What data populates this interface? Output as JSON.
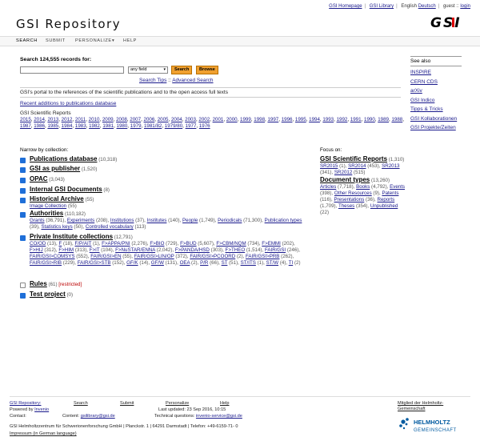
{
  "topbar": {
    "homepage": "GSI Homepage",
    "library": "GSI Library",
    "lang_current": "English",
    "lang_other": "Deutsch",
    "user": "guest",
    "login": "login"
  },
  "site_title": "GSI Repository",
  "logo_text": "GSI",
  "nav": [
    "SEARCH",
    "SUBMIT",
    "PERSONALIZE",
    "HELP"
  ],
  "search": {
    "heading": "Search 124,555 records for:",
    "input_value": "",
    "field_value": "any field",
    "search_button": "Search",
    "browse_button": "Browse",
    "tips": "Search Tips",
    "separator": "::",
    "advanced": "Advanced Search"
  },
  "portal_text": "GSI's portal to the references of the scientific publications and to the open access full texts",
  "recent_link": "Recent additions to publications database",
  "sci_reports_title": "GSI Scientific Reports",
  "years": [
    "2015",
    "2014",
    "2013",
    "2012",
    "2011",
    "2010",
    "2009",
    "2008",
    "2007",
    "2006",
    "2005",
    "2004",
    "2003",
    "2002",
    "2001",
    "2000",
    "1999",
    "1998",
    "1997",
    "1996",
    "1995",
    "1994",
    "1993",
    "1992",
    "1991",
    "1990",
    "1989",
    "1988",
    "1987",
    "1986",
    "1985",
    "1984",
    "1983",
    "1982",
    "1981",
    "1980",
    "1979",
    "1981/82",
    "1979/80",
    "1977",
    "1976"
  ],
  "see_also": {
    "heading": "See also",
    "items": [
      "INSPIRE",
      "CERN CDS",
      "arXiv",
      "GSI Indico",
      "Tipps & Tricks",
      "GSI Kollaborationen",
      "GSI Projekte/Zeiten"
    ]
  },
  "narrow_title": "Narrow by collection:",
  "collections": [
    {
      "name": "Publications database",
      "count": "(10,318)",
      "checked": true
    },
    {
      "name": "GSI as publisher",
      "count": "(1,520)",
      "checked": true
    },
    {
      "name": "OPAC",
      "count": "(3,043)",
      "checked": true
    },
    {
      "name": "Internal GSI Documents",
      "count": "(8)",
      "checked": true
    },
    {
      "name": "Historical Archive",
      "count": "(55)",
      "checked": true,
      "sub": [
        [
          "Image Collection",
          "(55)"
        ]
      ]
    },
    {
      "name": "Authorities",
      "count": "(110,182)",
      "checked": true,
      "sub": [
        [
          "Grants",
          "(36,791)"
        ],
        [
          "Experiments",
          "(208)"
        ],
        [
          "Institutions",
          "(37)"
        ],
        [
          "Institutes",
          "(140)"
        ],
        [
          "People",
          "(1,749)"
        ],
        [
          "Periodicals",
          "(71,300)"
        ],
        [
          "Publication types",
          "(39)"
        ],
        [
          "Statistics keys",
          "(50)"
        ],
        [
          "Controlled vocabulary",
          "(113)"
        ]
      ]
    },
    {
      "name": "Private Institute collections",
      "count": "(12,791)",
      "checked": true,
      "sub": [
        [
          "CO/OD",
          "(13)"
        ],
        [
          "F",
          "(18)"
        ],
        [
          "F/P/AIT",
          "(1)"
        ],
        [
          "F>APPA/PNI",
          "(2,276)"
        ],
        [
          "F>BIO",
          "(729)"
        ],
        [
          "F>BUD",
          "(5,607)"
        ],
        [
          "F>CBM/NQM",
          "(734)"
        ],
        [
          "F>EMMI",
          "(202)"
        ],
        [
          "F>HIJ",
          "(312)"
        ],
        [
          "F>HIM",
          "(313)"
        ],
        [
          "F>IT",
          "(104)"
        ],
        [
          "F>NuSTAR/ENNA",
          "(2,042)"
        ],
        [
          "F>PANDA/HSD",
          "(303)"
        ],
        [
          "F>THEO",
          "(1,514)"
        ],
        [
          "FAIR/GSI",
          "(246)"
        ],
        [
          "FAIR/GSI>COMSYS",
          "(552)"
        ],
        [
          "FAIR/GSI>EN",
          "(55)"
        ],
        [
          "FAIR/GSI>LIN/OP",
          "(372)"
        ],
        [
          "FAIR/GSI>PCOORD",
          "(2)"
        ],
        [
          "FAIR/GSI>PRB",
          "(262)"
        ],
        [
          "FAIR/GSI>RIB",
          "(229)"
        ],
        [
          "FAIR/GSI>STB",
          "(152)"
        ],
        [
          "GF/K",
          "(14)"
        ],
        [
          "GF/W",
          "(131)"
        ],
        [
          "OEA",
          "(2)"
        ],
        [
          "P/R",
          "(66)"
        ],
        [
          "ST",
          "(51)"
        ],
        [
          "ST/ITS",
          "(1)"
        ],
        [
          "ST/W",
          "(4)"
        ],
        [
          "TI",
          "(2)"
        ]
      ]
    },
    {
      "name": "Rules",
      "count": "(61)",
      "checked": false,
      "restricted": "[restricted]"
    },
    {
      "name": "Test project",
      "count": "(0)",
      "checked": true
    }
  ],
  "focus": {
    "heading": "Focus on:",
    "groups": [
      {
        "name": "GSI Scientific Reports",
        "count": "(1,310)",
        "items": [
          [
            "SR2015",
            "(1)"
          ],
          [
            "SR2014",
            "(453)"
          ],
          [
            "SR2013",
            "(341)"
          ],
          [
            "SR2012",
            "(515)"
          ]
        ]
      },
      {
        "name": "Document types",
        "count": "(13,260)",
        "items": [
          [
            "Articles",
            "(7,718)"
          ],
          [
            "Books",
            "(4,792)"
          ],
          [
            "Events",
            "(398)"
          ],
          [
            "Other Resources",
            "(9)"
          ],
          [
            "Patents",
            "(116)"
          ],
          [
            "Presentations",
            "(36)"
          ],
          [
            "Reports",
            "(1,709)"
          ],
          [
            "Theses",
            "(354)"
          ],
          [
            "Unpublished",
            "(22)"
          ]
        ]
      }
    ]
  },
  "footer": {
    "repo": "GSI Repository:",
    "search": "Search",
    "submit": "Submit",
    "personalize": "Personalize",
    "help": "Help",
    "powered": "Powered by",
    "invenio": "Invenio",
    "updated": "Last updated: 23 Sep 2016, 10:15",
    "contact_label": "Contact:",
    "content": "Content:",
    "content_email": "gsilibrary@gsi.de",
    "tech": "Technical questions:",
    "tech_email": "invenio-service@gsi.de",
    "member": "Mitglied der Helmholtz-Gemeinschaft",
    "address": "GSI Helmholtzzentrum für Schwerionenforschung GmbH | Planckstr. 1 | 64291 Darmstadt | Telefon: +49-6159-71- 0",
    "impressum": "Impressum (in German language)",
    "helm_logo_top": "HELMHOLTZ",
    "helm_logo_bottom": "GEMEINSCHAFT"
  },
  "colors": {
    "accent_button": "#f0a030",
    "link": "#1a1a8c",
    "checkbox": "#1f6fd8",
    "restricted": "#bb0000",
    "helmholtz_blue": "#005aa0"
  }
}
